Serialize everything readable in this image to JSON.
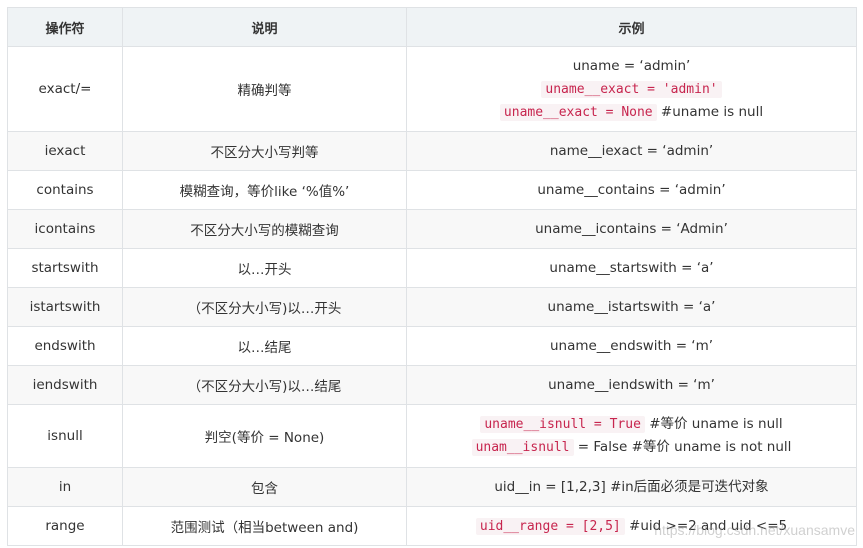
{
  "headers": [
    "操作符",
    "说明",
    "示例"
  ],
  "rows": [
    {
      "op": "exact/=",
      "desc": "精确判等",
      "ex": [
        {
          "text": "uname = ‘admin’",
          "code": false,
          "suffix": ""
        },
        {
          "text": "uname__exact = 'admin'",
          "code": true,
          "suffix": ""
        },
        {
          "text": "uname__exact = None",
          "code": true,
          "suffix": " #uname is null"
        }
      ]
    },
    {
      "op": "iexact",
      "desc": "不区分大小写判等",
      "ex": [
        {
          "text": "name__iexact = ‘admin’",
          "code": false,
          "suffix": ""
        }
      ]
    },
    {
      "op": "contains",
      "desc": "模糊查询，等价like ‘%值%’",
      "ex": [
        {
          "text": "uname__contains = ‘admin’",
          "code": false,
          "suffix": ""
        }
      ]
    },
    {
      "op": "icontains",
      "desc": "不区分大小写的模糊查询",
      "ex": [
        {
          "text": "uname__icontains = ‘Admin’",
          "code": false,
          "suffix": ""
        }
      ]
    },
    {
      "op": "startswith",
      "desc": "以…开头",
      "ex": [
        {
          "text": "uname__startswith = ‘a’",
          "code": false,
          "suffix": ""
        }
      ]
    },
    {
      "op": "istartswith",
      "desc": "（不区分大小写)以…开头",
      "ex": [
        {
          "text": "uname__istartswith = ‘a’",
          "code": false,
          "suffix": ""
        }
      ]
    },
    {
      "op": "endswith",
      "desc": "以…结尾",
      "ex": [
        {
          "text": "uname__endswith = ‘m’",
          "code": false,
          "suffix": ""
        }
      ]
    },
    {
      "op": "iendswith",
      "desc": "（不区分大小写)以…结尾",
      "ex": [
        {
          "text": "uname__iendswith = ‘m’",
          "code": false,
          "suffix": ""
        }
      ]
    },
    {
      "op": "isnull",
      "desc": "判空(等价 = None)",
      "ex": [
        {
          "text": "uname__isnull = True",
          "code": true,
          "suffix": " #等价 uname is null"
        },
        {
          "text": "unam__isnull",
          "code": true,
          "suffix": " = False #等价 uname is not null"
        }
      ]
    },
    {
      "op": "in",
      "desc": "包含",
      "ex": [
        {
          "text": "uid__in = [1,2,3] #in后面必须是可迭代对象",
          "code": false,
          "suffix": ""
        }
      ]
    },
    {
      "op": "range",
      "desc": "范围测试（相当between and)",
      "ex": [
        {
          "text": "uid__range = [2,5]",
          "code": true,
          "suffix": " #uid >=2 and uid <=5"
        }
      ]
    }
  ],
  "watermark": "https://blog.csdn.net/xuansamve",
  "colors": {
    "header_bg": "#eff3f5",
    "stripe_bg": "#f8f8f8",
    "border": "#dfe2e5",
    "code_fg": "#c7254e",
    "code_bg": "#f9f2f4"
  }
}
